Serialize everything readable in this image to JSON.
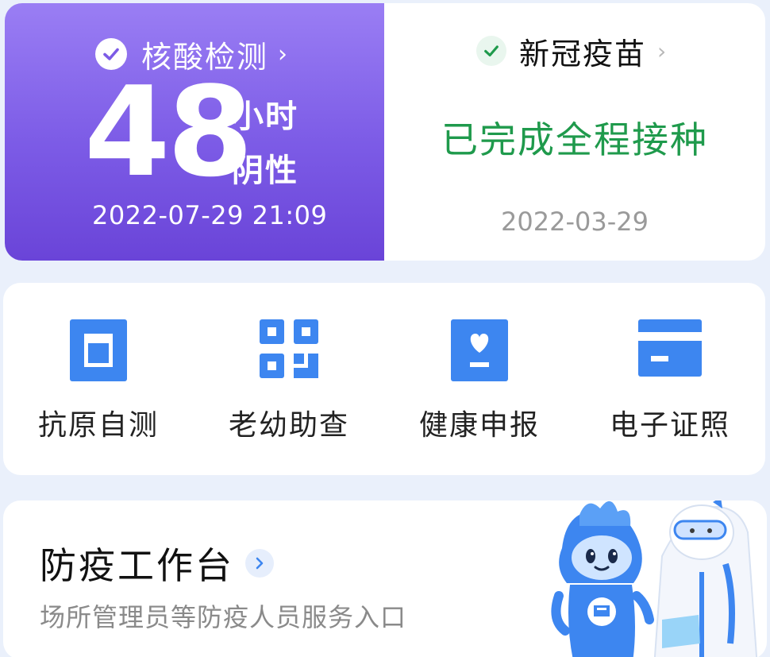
{
  "nucleic_test": {
    "title": "核酸检测",
    "hours": "48",
    "unit": "小时",
    "result": "阴性",
    "timestamp": "2022-07-29 21:09",
    "status_icon": "check-circle-icon",
    "bg_color": "#7c5be6"
  },
  "vaccine": {
    "title": "新冠疫苗",
    "status": "已完成全程接种",
    "date": "2022-03-29",
    "status_icon": "check-circle-icon",
    "status_color": "#1f9a4c"
  },
  "services": [
    {
      "label": "抗原自测",
      "icon": "antigen-test-icon"
    },
    {
      "label": "老幼助查",
      "icon": "qr-code-icon"
    },
    {
      "label": "健康申报",
      "icon": "health-declaration-icon"
    },
    {
      "label": "电子证照",
      "icon": "card-icon"
    }
  ],
  "workstation": {
    "title": "防疫工作台",
    "subtitle": "场所管理员等防疫人员服务入口",
    "illustration": "mascot-illustration"
  },
  "accent_color": "#3d86f0"
}
